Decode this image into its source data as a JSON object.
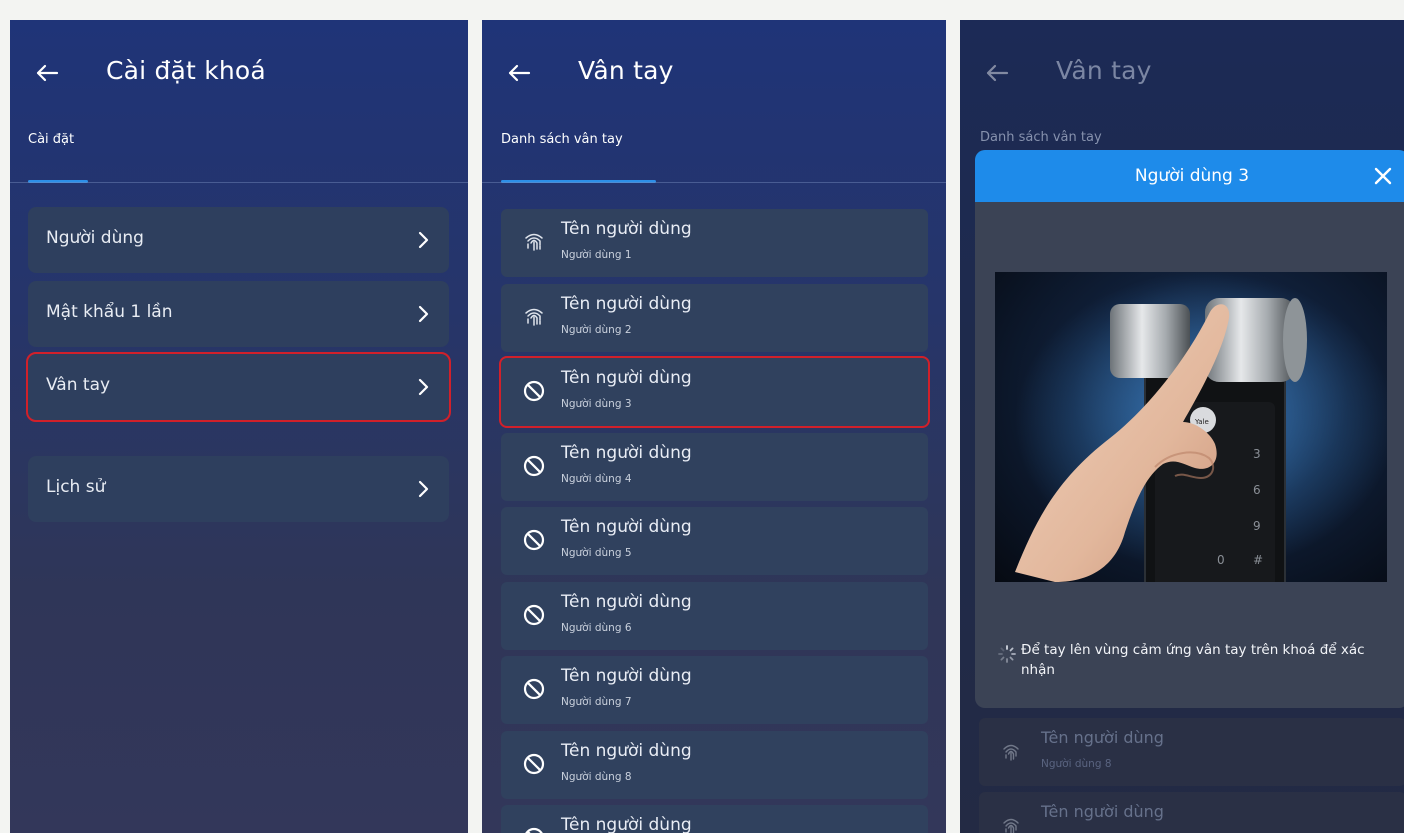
{
  "screen1": {
    "title": "Cài đặt khoá",
    "tab": "Cài đặt",
    "items": [
      {
        "label": "Người dùng"
      },
      {
        "label": "Mật khẩu 1 lần"
      },
      {
        "label": "Vân tay"
      },
      {
        "label": "Lịch sử"
      }
    ]
  },
  "screen2": {
    "title": "Vân tay",
    "tab": "Danh sách vân tay",
    "items": [
      {
        "name": "Tên người dùng",
        "sub": "Người dùng 1",
        "status": "fingerprint-icon"
      },
      {
        "name": "Tên người dùng",
        "sub": "Người dùng 2",
        "status": "fingerprint-icon"
      },
      {
        "name": "Tên người dùng",
        "sub": "Người dùng 3",
        "status": "blocked-icon"
      },
      {
        "name": "Tên người dùng",
        "sub": "Người dùng 4",
        "status": "blocked-icon"
      },
      {
        "name": "Tên người dùng",
        "sub": "Người dùng 5",
        "status": "blocked-icon"
      },
      {
        "name": "Tên người dùng",
        "sub": "Người dùng 6",
        "status": "blocked-icon"
      },
      {
        "name": "Tên người dùng",
        "sub": "Người dùng 7",
        "status": "blocked-icon"
      },
      {
        "name": "Tên người dùng",
        "sub": "Người dùng 8",
        "status": "blocked-icon"
      },
      {
        "name": "Tên người dùng",
        "sub": "",
        "status": "blocked-icon"
      }
    ]
  },
  "screen3": {
    "title": "Vân tay",
    "tab": "Danh sách vân tay",
    "modal": {
      "title": "Người dùng 3",
      "hint": "Để tay lên vùng cảm ứng vân tay trên khoá để xác nhận",
      "lock_brand": "Yale",
      "keypad": [
        "3",
        "6",
        "9",
        "0",
        "#"
      ]
    },
    "background_items": [
      {
        "name": "Tên người dùng",
        "sub": "Người dùng 8"
      },
      {
        "name": "Tên người dùng",
        "sub": ""
      }
    ]
  },
  "colors": {
    "accent": "#1e8bea",
    "highlight": "#d1202a",
    "card": "#2e3f5e"
  }
}
